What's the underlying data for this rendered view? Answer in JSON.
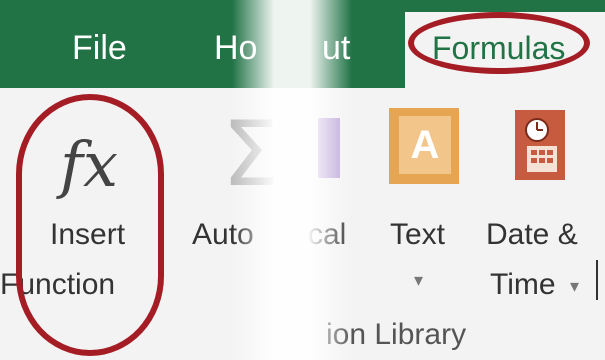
{
  "tabs": {
    "file": "File",
    "home_fragment": "Ho",
    "page_layout_fragment": "ut",
    "formulas": "Formulas"
  },
  "ribbon": {
    "insert_function": {
      "line1": "Insert",
      "line2": "Function",
      "icon": "fx-icon"
    },
    "autosum": {
      "label": "Auto",
      "icon": "sigma-icon"
    },
    "logical": {
      "label": "cal",
      "icon": "logical-book-icon"
    },
    "text": {
      "label": "Text",
      "icon": "text-book-icon",
      "glyph": "A"
    },
    "date_time": {
      "line1": "Date &",
      "line2": "Time",
      "icon": "date-time-book-icon"
    },
    "group_label": "ion Library"
  },
  "colors": {
    "accent": "#217346",
    "highlight": "#a51d24"
  }
}
